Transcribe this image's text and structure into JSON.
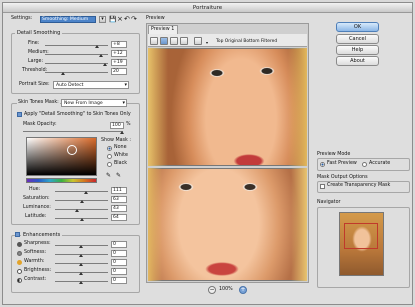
{
  "window": {
    "title": "Portraiture"
  },
  "toolbar": {
    "settings_label": "Settings:",
    "settings_value": "Smoothing: Medium"
  },
  "detail_smoothing": {
    "title": "Detail Smoothing",
    "rows": [
      {
        "label": "Fine:",
        "value": "+8"
      },
      {
        "label": "Medium:",
        "value": "+12"
      },
      {
        "label": "Large:",
        "value": "+19"
      },
      {
        "label": "Threshold:",
        "value": "20"
      }
    ],
    "portrait_size_label": "Portrait Size:",
    "portrait_size_value": "Auto Detect"
  },
  "skin_tones": {
    "mask_label": "Skin Tones Mask:",
    "mask_value": "New From Image",
    "apply_label": "Apply \"Detail Smoothing\" to Skin Tones Only",
    "opacity_label": "Mask Opacity:",
    "opacity_value": "100",
    "opacity_unit": "%",
    "show_mask_label": "Show Mask :",
    "show_mask_options": [
      "None",
      "White",
      "Black"
    ],
    "hsl": [
      {
        "label": "Hue:",
        "value": "111"
      },
      {
        "label": "Saturation:",
        "value": "63"
      },
      {
        "label": "Luminance:",
        "value": "43"
      },
      {
        "label": "Latitude:",
        "value": "64"
      }
    ]
  },
  "enhancements": {
    "title": "Enhancements",
    "rows": [
      {
        "label": "Sharpness:",
        "value": "0"
      },
      {
        "label": "Softness:",
        "value": "0"
      },
      {
        "label": "Warmth:",
        "value": "0"
      },
      {
        "label": "Brightness:",
        "value": "0"
      },
      {
        "label": "Contrast:",
        "value": "0"
      }
    ]
  },
  "preview": {
    "title": "Preview",
    "tab": "Preview 1",
    "option_label": "Top Original Bottom Filtered",
    "zoom": "100%"
  },
  "buttons": {
    "ok": "OK",
    "cancel": "Cancel",
    "help": "Help",
    "about": "About"
  },
  "preview_mode": {
    "title": "Preview Mode",
    "fast": "Fast Preview",
    "accurate": "Accurate"
  },
  "mask_output": {
    "title": "Mask Output Options",
    "create": "Create Transparency Mask"
  },
  "navigator": {
    "title": "Navigator"
  }
}
